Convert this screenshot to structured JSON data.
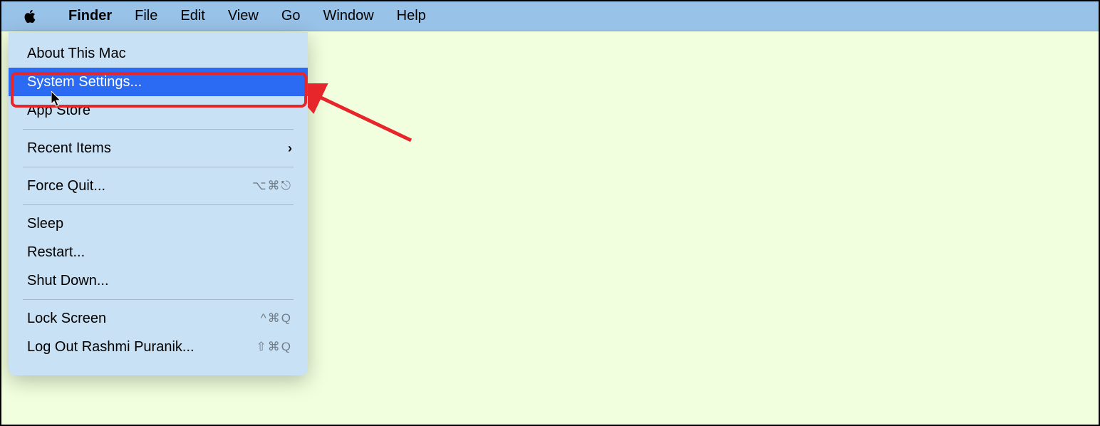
{
  "menubar": {
    "items": [
      {
        "label": "Finder",
        "bold": true
      },
      {
        "label": "File"
      },
      {
        "label": "Edit"
      },
      {
        "label": "View"
      },
      {
        "label": "Go"
      },
      {
        "label": "Window"
      },
      {
        "label": "Help"
      }
    ]
  },
  "dropdown": {
    "about": "About This Mac",
    "system_settings": "System Settings...",
    "app_store": "App Store",
    "recent_items": "Recent Items",
    "force_quit": "Force Quit...",
    "force_quit_shortcut": "⌥⌘⎋",
    "sleep": "Sleep",
    "restart": "Restart...",
    "shutdown": "Shut Down...",
    "lock_screen": "Lock Screen",
    "lock_screen_shortcut": "^⌘Q",
    "logout": "Log Out Rashmi Puranik...",
    "logout_shortcut": "⇧⌘Q"
  },
  "annotation": {
    "highlight_color": "#e6262a"
  }
}
